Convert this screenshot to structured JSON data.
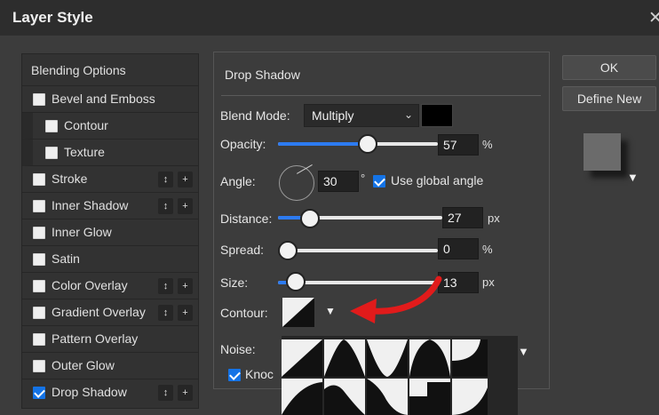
{
  "dialog": {
    "title": "Layer Style"
  },
  "sidebar": {
    "items": [
      {
        "label": "Blending Options",
        "checked": null,
        "has_controls": false
      },
      {
        "label": "Bevel and Emboss",
        "checked": false,
        "has_controls": false
      },
      {
        "label": "Contour",
        "checked": false,
        "has_controls": false,
        "indent": true
      },
      {
        "label": "Texture",
        "checked": false,
        "has_controls": false,
        "indent": true
      },
      {
        "label": "Stroke",
        "checked": false,
        "has_controls": true
      },
      {
        "label": "Inner Shadow",
        "checked": false,
        "has_controls": true
      },
      {
        "label": "Inner Glow",
        "checked": false,
        "has_controls": false
      },
      {
        "label": "Satin",
        "checked": false,
        "has_controls": false
      },
      {
        "label": "Color Overlay",
        "checked": false,
        "has_controls": true
      },
      {
        "label": "Gradient Overlay",
        "checked": false,
        "has_controls": true
      },
      {
        "label": "Pattern Overlay",
        "checked": false,
        "has_controls": false
      },
      {
        "label": "Outer Glow",
        "checked": false,
        "has_controls": false
      },
      {
        "label": "Drop Shadow",
        "checked": true,
        "has_controls": true
      }
    ],
    "move_glyph": "↕",
    "add_glyph": "+"
  },
  "buttons": {
    "ok": "OK",
    "define_new": "Define New"
  },
  "panel": {
    "title": "Drop Shadow",
    "blend_mode": {
      "label": "Blend Mode:",
      "value": "Multiply",
      "color": "#000000"
    },
    "opacity": {
      "label": "Opacity:",
      "value": "57",
      "unit": "%",
      "level": 0.57
    },
    "angle": {
      "label": "Angle:",
      "value": "30",
      "unit": "°",
      "use_global_label": "Use global angle",
      "use_global": true
    },
    "distance": {
      "label": "Distance:",
      "value": "27",
      "unit": "px"
    },
    "spread": {
      "label": "Spread:",
      "value": "0",
      "unit": "%"
    },
    "size": {
      "label": "Size:",
      "value": "13",
      "unit": "px"
    },
    "contour": {
      "label": "Contour:"
    },
    "noise": {
      "label": "Noise:"
    },
    "knockout": {
      "label": "Knoc",
      "checked": true
    }
  },
  "colors": {
    "accent": "#2d7bf1",
    "checkbox_accent": "#1473e6",
    "annotation_arrow": "#e11b1b"
  },
  "icons": {
    "close": "close-icon",
    "chevron": "chevron-down-icon",
    "dropdown": "triangle-down-icon"
  }
}
